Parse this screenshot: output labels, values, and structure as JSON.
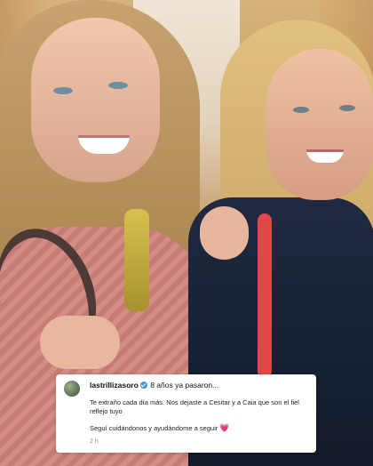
{
  "comment": {
    "username": "lastrillizasoro",
    "first_line": "8 años ya pasaron...",
    "paragraph_1": "Te extraño cada día más. Nos dejaste a Cesitar y a Caia que son el fiel reflejo tuyo",
    "paragraph_2": "Seguí cuidándonos y ayudándome a seguir",
    "emoji": "💗",
    "timestamp": "2 h",
    "icons": {
      "avatar": "profile-avatar",
      "verified": "verified-badge-icon",
      "heart": "pink-heart-emoji"
    }
  },
  "photo": {
    "subject": "two-women-smiling"
  },
  "colors": {
    "comment_background": "#ffffff",
    "verified_badge": "#3897f0",
    "timestamp_text": "#8e8e8e"
  }
}
